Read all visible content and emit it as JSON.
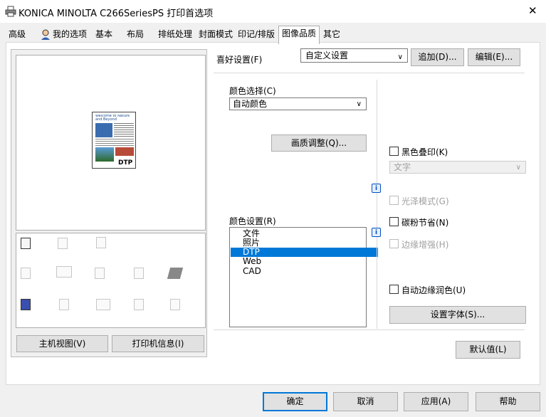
{
  "window": {
    "title": "KONICA MINOLTA C266SeriesPS 打印首选项",
    "close": "✕"
  },
  "tabs": [
    {
      "label": "高级"
    },
    {
      "label": "我的选项"
    },
    {
      "label": "基本"
    },
    {
      "label": "布局"
    },
    {
      "label": "排纸处理"
    },
    {
      "label": "封面模式"
    },
    {
      "label": "印记/排版"
    },
    {
      "label": "图像品质"
    },
    {
      "label": "其它"
    }
  ],
  "preview": {
    "thumbnail_text": "DTP",
    "doc_title": "Welcome to Nature and Beyond",
    "host_view_button": "主机视图(V)",
    "printer_info_button": "打印机信息(I)"
  },
  "favorite": {
    "label": "喜好设置(F)",
    "value": "自定义设置",
    "add_button": "追加(D)...",
    "edit_button": "编辑(E)..."
  },
  "color_select": {
    "label": "颜色选择(C)",
    "value": "自动颜色"
  },
  "quality_button": "画质调整(Q)...",
  "color_settings": {
    "label": "颜色设置(R)",
    "items": [
      "文件",
      "照片",
      "DTP",
      "Web",
      "CAD"
    ],
    "selected_index": 2
  },
  "black_overprint": {
    "label": "黑色叠印(K)",
    "value": "文字"
  },
  "glossy_mode": {
    "label": "光泽模式(G)"
  },
  "toner_save": {
    "label": "碳粉节省(N)"
  },
  "edge_enhance": {
    "label": "边缘增强(H)"
  },
  "auto_trapping": {
    "label": "自动边缘润色(U)"
  },
  "font_button": "设置字体(S)...",
  "default_button": "默认值(L)",
  "footer": {
    "ok": "确定",
    "cancel": "取消",
    "apply": "应用(A)",
    "help": "帮助"
  },
  "info_glyph": "i",
  "colors": {
    "selection": "#0078d7",
    "button": "#e1e1e1",
    "border": "#adadad"
  }
}
